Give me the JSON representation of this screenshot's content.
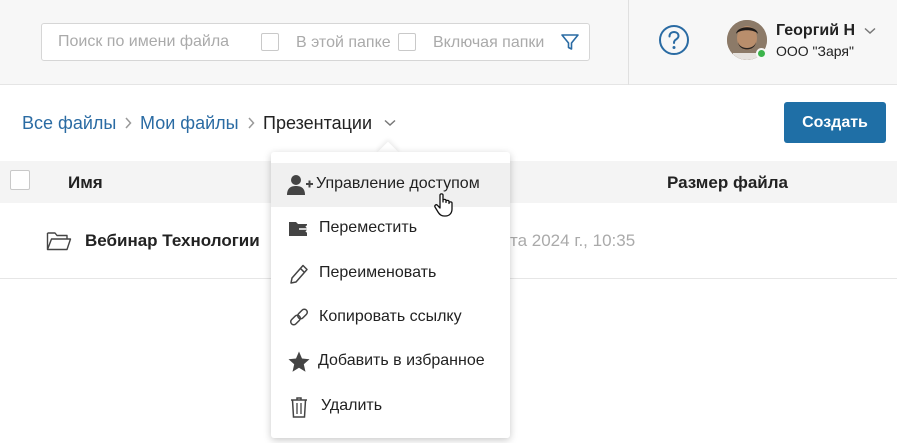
{
  "search": {
    "placeholder": "Поиск по имени файла",
    "in_folder_label": "В этой папке",
    "include_folders_label": "Включая папки"
  },
  "user": {
    "name": "Георгий Н",
    "org": "ООО \"Заря\"",
    "status_color": "#3cb44b"
  },
  "breadcrumb": {
    "items": [
      "Все файлы",
      "Мои файлы",
      "Презентации"
    ]
  },
  "actions": {
    "create_label": "Создать",
    "accent_color": "#1f6fa6"
  },
  "table": {
    "columns": {
      "name": "Имя",
      "size": "Размер файла"
    },
    "rows": [
      {
        "name": "Вебинар Технологии",
        "date_partial": "та 2024 г., 10:35"
      }
    ]
  },
  "menu": {
    "items": [
      {
        "label": "Управление доступом",
        "icon": "user-plus-icon"
      },
      {
        "label": "Переместить",
        "icon": "move-folder-icon"
      },
      {
        "label": "Переименовать",
        "icon": "pencil-icon"
      },
      {
        "label": "Копировать ссылку",
        "icon": "link-icon"
      },
      {
        "label": "Добавить в избранное",
        "icon": "star-icon"
      },
      {
        "label": "Удалить",
        "icon": "trash-icon"
      }
    ]
  }
}
